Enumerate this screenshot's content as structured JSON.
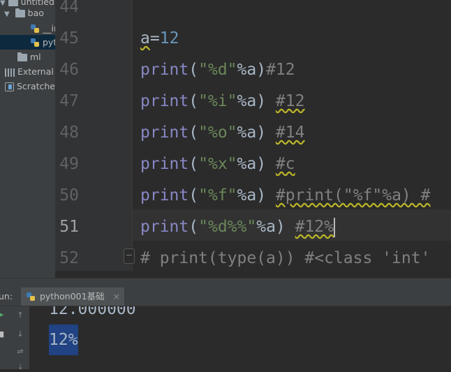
{
  "project_tree": {
    "items": [
      {
        "label": "untitled",
        "kind": "folder"
      },
      {
        "label": "bao",
        "kind": "folder",
        "expanded": true
      },
      {
        "label": "__in",
        "kind": "python-file"
      },
      {
        "label": "pyt",
        "kind": "python-file",
        "selected": true
      },
      {
        "label": "ml",
        "kind": "folder"
      },
      {
        "label": "External L",
        "kind": "libraries"
      },
      {
        "label": "Scratches",
        "kind": "scratches"
      }
    ]
  },
  "editor": {
    "current_line": 51,
    "line_numbers": [
      "44",
      "45",
      "46",
      "47",
      "48",
      "49",
      "50",
      "51",
      "52"
    ],
    "lines": {
      "l45": {
        "var": "a",
        "op": "=",
        "num": "12"
      },
      "l46": {
        "fn": "print",
        "open": "(",
        "str1": "\"",
        "fmt": "%d",
        "str2": "\"",
        "rest": "%a)",
        "comment": "#12"
      },
      "l47": {
        "fn": "print",
        "open": "(",
        "str1": "\"",
        "fmt": "%i",
        "str2": "\"",
        "rest": "%a) ",
        "comment": "#12"
      },
      "l48": {
        "fn": "print",
        "open": "(",
        "str1": "\"",
        "fmt": "%o",
        "str2": "\"",
        "rest": "%a) ",
        "comment": "#14"
      },
      "l49": {
        "fn": "print",
        "open": "(",
        "str1": "\"",
        "fmt": "%x",
        "str2": "\"",
        "rest": "%a) ",
        "comment": "#c"
      },
      "l50": {
        "fn": "print",
        "open": "(",
        "str1": "\"",
        "fmt": "%f",
        "str2": "\"",
        "rest": "%a) ",
        "comment": "#print(\"%f\"%a) #"
      },
      "l51": {
        "fn": "print",
        "open": "(",
        "str1": "\"",
        "fmt": "%d%%",
        "str2": "\"",
        "rest": "%a) ",
        "comment": "#12%"
      },
      "l52": {
        "comment": "# print(type(a)) #<class 'int'"
      }
    }
  },
  "run_panel": {
    "label": "un:",
    "tab_title": "python001基础",
    "output": [
      "12.000000",
      "12%"
    ]
  },
  "colors": {
    "editor_bg": "#2b2b2b",
    "keyword": "#8888c6",
    "string": "#6a8759",
    "number": "#6897bb",
    "comment": "#808080",
    "selection": "#214283"
  }
}
